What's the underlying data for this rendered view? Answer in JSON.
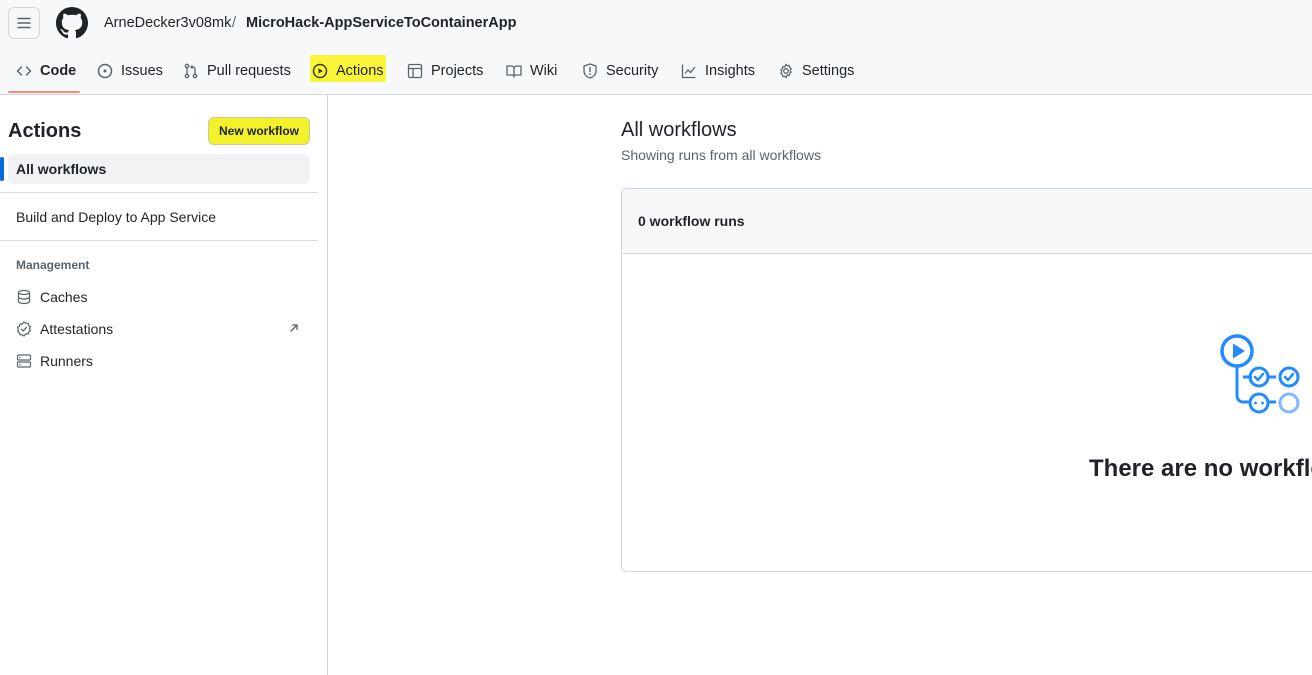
{
  "header": {
    "owner": "ArneDecker3v08mk",
    "separator": "/",
    "repo": "MicroHack-AppServiceToContainerApp"
  },
  "tabs": [
    {
      "label": "Code",
      "icon": "code-icon",
      "active": true
    },
    {
      "label": "Issues",
      "icon": "issue-opened-icon"
    },
    {
      "label": "Pull requests",
      "icon": "git-pull-request-icon"
    },
    {
      "label": "Actions",
      "icon": "play-icon",
      "highlighted": true
    },
    {
      "label": "Projects",
      "icon": "table-icon"
    },
    {
      "label": "Wiki",
      "icon": "book-icon"
    },
    {
      "label": "Security",
      "icon": "shield-icon"
    },
    {
      "label": "Insights",
      "icon": "graph-icon"
    },
    {
      "label": "Settings",
      "icon": "gear-icon"
    }
  ],
  "sidebar": {
    "title": "Actions",
    "new_workflow": "New workflow",
    "items": [
      {
        "label": "All workflows",
        "selected": true
      },
      {
        "label": "Build and Deploy to App Service"
      }
    ],
    "management_heading": "Management",
    "management": [
      {
        "label": "Caches",
        "icon": "database-icon"
      },
      {
        "label": "Attestations",
        "icon": "verified-icon",
        "external": true
      },
      {
        "label": "Runners",
        "icon": "server-icon"
      }
    ]
  },
  "main": {
    "title": "All workflows",
    "subtitle": "Showing runs from all workflows",
    "runs_count": "0 workflow runs",
    "empty_text": "There are no workflo"
  },
  "colors": {
    "accent": "#0969da",
    "highlight": "#fbf53a",
    "tab_underline": "#fd8c73",
    "illustration": "#218bff"
  }
}
